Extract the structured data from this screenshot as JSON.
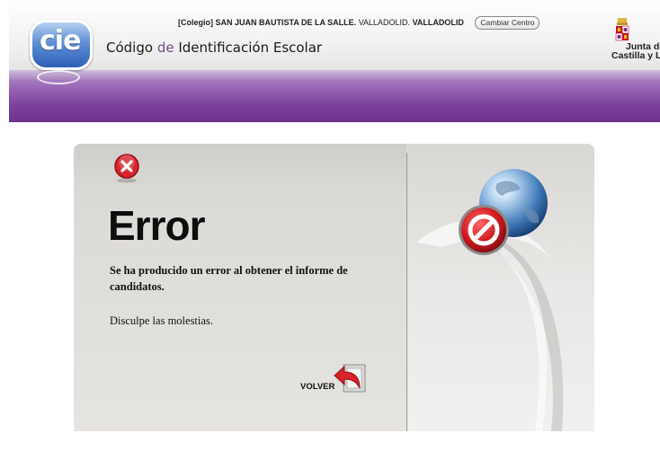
{
  "header": {
    "logo_text": "cie",
    "school_prefix": "[Colegio] SAN JUAN BAUTISTA DE LA SALLE.",
    "school_city": "VALLADOLID.",
    "school_province": "VALLADOLID",
    "change_center_label": "Cambiar Centro",
    "title_part1": "Código",
    "title_part2": "de",
    "title_part3": "Identificación Escolar",
    "institution_line1": "Junta de",
    "institution_line2": "Castilla y León"
  },
  "error": {
    "title": "Error",
    "message": "Se ha producido un error al obtener el informe de candidatos.",
    "apology": "Disculpe las molestias.",
    "back_label": "VOLVER"
  },
  "colors": {
    "purple_band": "#7a3e99",
    "error_red": "#d8232a",
    "logo_blue": "#2e5fb8"
  }
}
